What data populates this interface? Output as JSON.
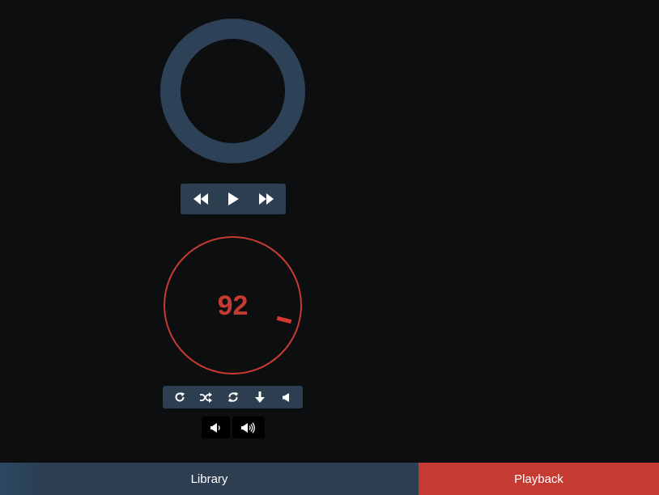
{
  "player": {
    "progress_ring": {
      "color": "#2e4257"
    },
    "transport": {
      "rewind_icon": "rewind-icon",
      "play_icon": "play-icon",
      "fast_forward_icon": "fast-forward-icon",
      "bar_color": "#2c3e50"
    },
    "volume_dial": {
      "value": "92",
      "color": "#c63b31"
    },
    "options": {
      "icons": [
        "redo-icon",
        "shuffle-icon",
        "repeat-icon",
        "download-icon",
        "volume-off-icon"
      ]
    },
    "volume_buttons": {
      "down_icon": "volume-down-icon",
      "up_icon": "volume-up-icon"
    }
  },
  "bottom_nav": {
    "library_label": "Library",
    "playback_label": "Playback",
    "library_color": "#2c3e50",
    "playback_color": "#c63b31"
  }
}
